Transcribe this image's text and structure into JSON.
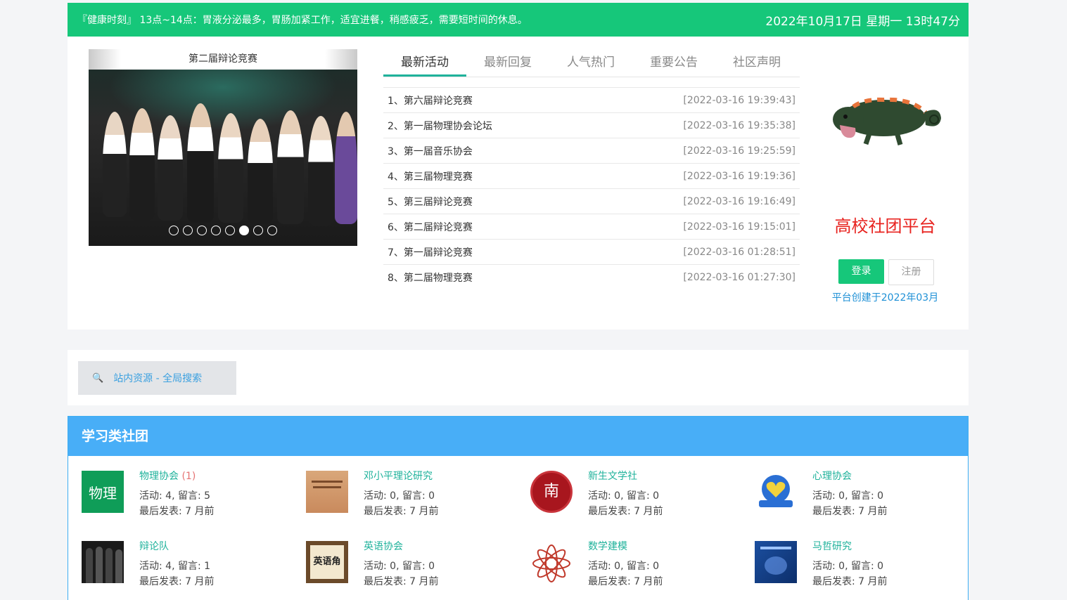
{
  "topbar": {
    "tip": "『健康时刻』 13点~14点：胃液分泌最多，胃肠加紧工作，适宜进餐，稍感疲乏，需要短时间的休息。",
    "clock": "2022年10月17日 星期一 13时47分"
  },
  "carousel": {
    "caption": "第二届辩论竞赛",
    "slide_count": 8,
    "active_index": 5
  },
  "tabs": [
    "最新活动",
    "最新回复",
    "人气热门",
    "重要公告",
    "社区声明"
  ],
  "activities": [
    {
      "title": "1、第六届辩论竞赛",
      "time": "[2022-03-16 19:39:43]"
    },
    {
      "title": "2、第一届物理协会论坛",
      "time": "[2022-03-16 19:35:38]"
    },
    {
      "title": "3、第一届音乐协会",
      "time": "[2022-03-16 19:25:59]"
    },
    {
      "title": "4、第三届物理竞赛",
      "time": "[2022-03-16 19:19:36]"
    },
    {
      "title": "5、第三届辩论竞赛",
      "time": "[2022-03-16 19:16:49]"
    },
    {
      "title": "6、第二届辩论竞赛",
      "time": "[2022-03-16 19:15:01]"
    },
    {
      "title": "7、第一届辩论竞赛",
      "time": "[2022-03-16 01:28:51]"
    },
    {
      "title": "8、第二届物理竞赛",
      "time": "[2022-03-16 01:27:30]"
    }
  ],
  "sidebar": {
    "brand": "高校社团平台",
    "login": "登录",
    "register": "注册",
    "created": "平台创建于2022年03月"
  },
  "search": {
    "label": "站内资源 - 全局搜索"
  },
  "category": {
    "title": "学习类社团",
    "clubs": [
      {
        "name": "物理协会",
        "badge": "(1)",
        "stats": "活动: 4, 留言: 5",
        "last": "最后发表: 7 月前",
        "logo_text": "物理"
      },
      {
        "name": "邓小平理论研究",
        "badge": "",
        "stats": "活动: 0, 留言: 0",
        "last": "最后发表: 7 月前"
      },
      {
        "name": "新生文学社",
        "badge": "",
        "stats": "活动: 0, 留言: 0",
        "last": "最后发表: 7 月前",
        "logo_text": "南"
      },
      {
        "name": "心理协会",
        "badge": "",
        "stats": "活动: 0, 留言: 0",
        "last": "最后发表: 7 月前"
      },
      {
        "name": "辩论队",
        "badge": "",
        "stats": "活动: 4, 留言: 1",
        "last": "最后发表: 7 月前"
      },
      {
        "name": "英语协会",
        "badge": "",
        "stats": "活动: 0, 留言: 0",
        "last": "最后发表: 7 月前",
        "logo_text": "英语角"
      },
      {
        "name": "数学建模",
        "badge": "",
        "stats": "活动: 0, 留言: 0",
        "last": "最后发表: 7 月前"
      },
      {
        "name": "马哲研究",
        "badge": "",
        "stats": "活动: 0, 留言: 0",
        "last": "最后发表: 7 月前"
      }
    ]
  },
  "colors": {
    "accent_green": "#16c77a",
    "header_blue": "#48aef7",
    "brand_red": "#e8231f",
    "link_teal": "#1fb29b"
  }
}
